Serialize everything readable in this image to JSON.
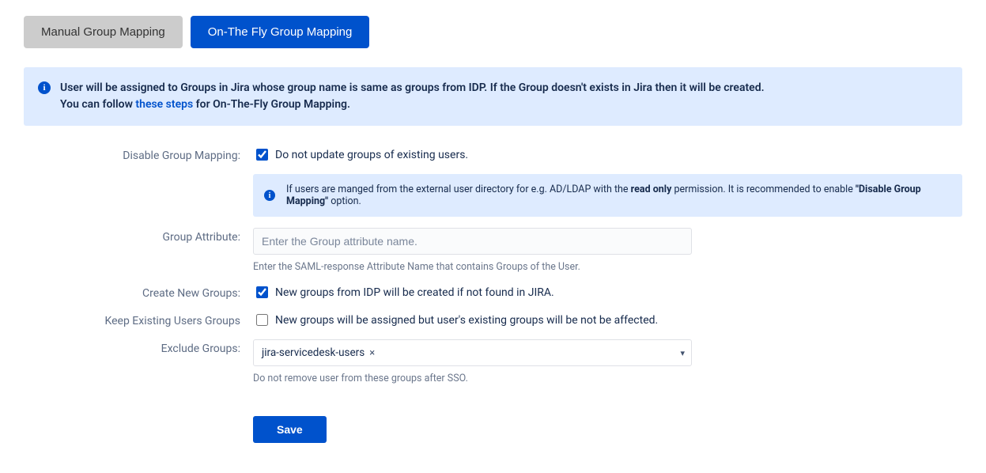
{
  "tabs": {
    "manual": "Manual Group Mapping",
    "onthefly": "On-The Fly Group Mapping"
  },
  "banner": {
    "line1_part1": "User will be assigned to Groups in Jira whose group name is same as groups from IDP. If the Group doesn't exists in Jira then it will be created.",
    "line2_prefix": "You can follow ",
    "line2_link": "these steps",
    "line2_suffix": " for On-The-Fly Group Mapping."
  },
  "form": {
    "disable_group_mapping": {
      "label": "Disable Group Mapping:",
      "checkbox_label": "Do not update groups of existing users.",
      "checked": true,
      "info_prefix": "If users are manged from the external user directory for e.g. AD/LDAP with the ",
      "info_bold1": "read only",
      "info_mid": " permission. It is recommended to enable ",
      "info_bold2": "\"Disable Group Mapping\"",
      "info_suffix": " option."
    },
    "group_attribute": {
      "label": "Group Attribute:",
      "placeholder": "Enter the Group attribute name.",
      "value": "",
      "help": "Enter the SAML-response Attribute Name that contains Groups of the User."
    },
    "create_new_groups": {
      "label": "Create New Groups:",
      "checkbox_label": "New groups from IDP will be created if not found in JIRA.",
      "checked": true
    },
    "keep_existing": {
      "label": "Keep Existing Users Groups",
      "checkbox_label": "New groups will be assigned but user's existing groups will be not be affected.",
      "checked": false
    },
    "exclude_groups": {
      "label": "Exclude Groups:",
      "chip": "jira-servicedesk-users",
      "help": "Do not remove user from these groups after SSO."
    },
    "save": "Save"
  }
}
